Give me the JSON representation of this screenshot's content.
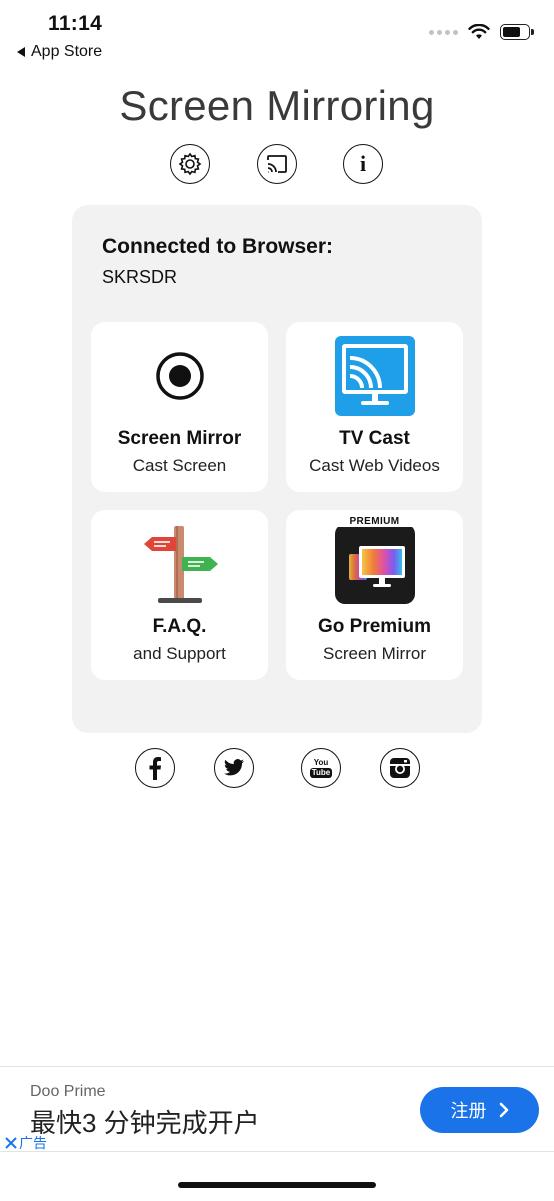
{
  "status_bar": {
    "time": "11:14",
    "back_label": "App Store"
  },
  "app": {
    "title": "Screen Mirroring"
  },
  "top_actions": {
    "icons": [
      "gear-icon",
      "cast-icon",
      "info-icon"
    ],
    "info_glyph": "i"
  },
  "connection": {
    "title": "Connected to Browser:",
    "name": "SKRSDR"
  },
  "cards": [
    {
      "title": "Screen Mirror",
      "subtitle": "Cast Screen",
      "icon": "record-icon"
    },
    {
      "title": "TV Cast",
      "subtitle": "Cast Web Videos",
      "icon": "tv-cast-icon"
    },
    {
      "title": "F.A.Q.",
      "subtitle": "and Support",
      "icon": "signpost-icon"
    },
    {
      "title": "Go Premium",
      "subtitle": "Screen Mirror",
      "icon": "premium-icon",
      "badge": "PREMIUM"
    }
  ],
  "social": {
    "icons": [
      "facebook-icon",
      "twitter-icon",
      "youtube-icon",
      "instagram-icon"
    ],
    "youtube_top": "You",
    "youtube_bottom": "Tube"
  },
  "ad": {
    "brand": "Doo Prime",
    "text": "最快3 分钟完成开户",
    "close_label": "广告",
    "cta": "注册"
  },
  "colors": {
    "panel_bg": "#f2f2f2",
    "tv_cast_blue": "#1e9fe8",
    "cta_blue": "#1a73e8",
    "signpost_red": "#e0453a",
    "signpost_green": "#3fb34f"
  }
}
